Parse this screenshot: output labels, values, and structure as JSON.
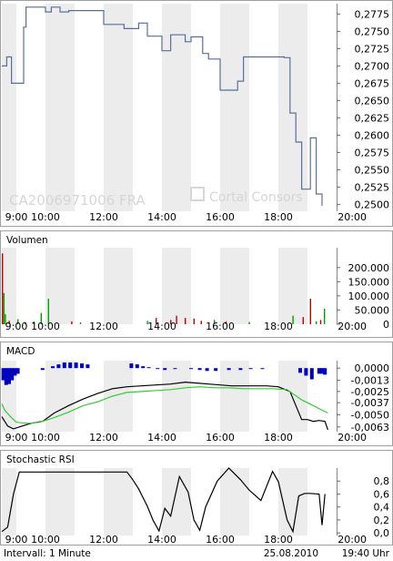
{
  "chart_data": [
    {
      "type": "line",
      "panel": "price",
      "ylim": [
        0.249,
        0.279
      ],
      "x_ticks": [
        "9:00",
        "10:00",
        "12:00",
        "14:00",
        "16:00",
        "18:00",
        "20:00"
      ],
      "y_ticks": [
        "0,2775",
        "0,2750",
        "0,2725",
        "0,2700",
        "0,2675",
        "0,2650",
        "0,2625",
        "0,2600",
        "0,2575",
        "0,2550",
        "0,2525",
        "0,2500"
      ],
      "y_tick_values": [
        0.2775,
        0.275,
        0.2725,
        0.27,
        0.2675,
        0.265,
        0.2625,
        0.26,
        0.2575,
        0.255,
        0.2525,
        0.25
      ],
      "x_range": [
        8.5,
        20.0
      ],
      "series": [
        {
          "color": "#5a6e9c",
          "x": [
            8.5,
            8.67,
            8.67,
            8.83,
            8.83,
            9.25,
            9.25,
            9.33,
            9.33,
            10.0,
            10.0,
            10.2,
            10.2,
            10.5,
            10.5,
            10.8,
            10.8,
            12.0,
            12.0,
            12.7,
            12.7,
            13.2,
            13.2,
            13.5,
            13.5,
            14.0,
            14.0,
            14.3,
            14.3,
            14.8,
            14.8,
            15.0,
            15.0,
            15.4,
            15.4,
            15.6,
            15.6,
            16.0,
            16.0,
            16.6,
            16.6,
            16.8,
            16.8,
            18.2,
            18.2,
            18.4,
            18.4,
            18.6,
            18.6,
            18.8,
            18.8,
            19.1,
            19.1,
            19.3,
            19.3,
            19.5,
            19.5
          ],
          "y": [
            0.27,
            0.27,
            0.2713,
            0.2713,
            0.2675,
            0.2675,
            0.2756,
            0.2756,
            0.2785,
            0.2785,
            0.2778,
            0.2778,
            0.2785,
            0.2785,
            0.2778,
            0.2778,
            0.278,
            0.278,
            0.276,
            0.276,
            0.2754,
            0.2754,
            0.2762,
            0.2762,
            0.2743,
            0.2743,
            0.2722,
            0.2722,
            0.2745,
            0.2745,
            0.2735,
            0.2735,
            0.2742,
            0.2742,
            0.2718,
            0.2718,
            0.271,
            0.271,
            0.2665,
            0.2665,
            0.2678,
            0.2678,
            0.2713,
            0.2713,
            0.2712,
            0.2712,
            0.2632,
            0.2632,
            0.259,
            0.259,
            0.2522,
            0.2522,
            0.2596,
            0.2596,
            0.2515,
            0.2515,
            0.2498
          ]
        }
      ],
      "watermark": "CA2006971006   FRA"
    },
    {
      "type": "bar",
      "panel": "volume",
      "title": "Volumen",
      "ylim": [
        0,
        270000
      ],
      "x_ticks": [
        "9:00",
        "10:00",
        "12:00",
        "14:00",
        "16:00",
        "18:00",
        "20:00"
      ],
      "y_ticks": [
        "200.000",
        "150.000",
        "100.000",
        "50.000",
        "0"
      ],
      "y_tick_values": [
        200000,
        150000,
        100000,
        50000,
        0
      ],
      "x_range": [
        8.5,
        20.0
      ],
      "bars": [
        {
          "x": 8.52,
          "v": 250000,
          "c": "#c00000"
        },
        {
          "x": 8.57,
          "v": 110000,
          "c": "#00a000"
        },
        {
          "x": 8.62,
          "v": 35000,
          "c": "#00a000"
        },
        {
          "x": 8.75,
          "v": 12000,
          "c": "#c00000"
        },
        {
          "x": 9.05,
          "v": 18000,
          "c": "#00a000"
        },
        {
          "x": 9.3,
          "v": 8000,
          "c": "#00a000"
        },
        {
          "x": 9.6,
          "v": 10000,
          "c": "#00a000"
        },
        {
          "x": 9.85,
          "v": 40000,
          "c": "#00a000"
        },
        {
          "x": 10.1,
          "v": 90000,
          "c": "#00a000"
        },
        {
          "x": 10.9,
          "v": 10000,
          "c": "#c00000"
        },
        {
          "x": 11.2,
          "v": 7000,
          "c": "#00a000"
        },
        {
          "x": 13.5,
          "v": 12000,
          "c": "#00a000"
        },
        {
          "x": 13.8,
          "v": 22000,
          "c": "#c00000"
        },
        {
          "x": 14.3,
          "v": 15000,
          "c": "#c00000"
        },
        {
          "x": 14.5,
          "v": 30000,
          "c": "#c00000"
        },
        {
          "x": 14.8,
          "v": 22000,
          "c": "#c00000"
        },
        {
          "x": 15.1,
          "v": 20000,
          "c": "#c00000"
        },
        {
          "x": 15.35,
          "v": 12000,
          "c": "#c00000"
        },
        {
          "x": 15.8,
          "v": 15000,
          "c": "#00a000"
        },
        {
          "x": 16.2,
          "v": 10000,
          "c": "#c00000"
        },
        {
          "x": 17.0,
          "v": 8000,
          "c": "#00a000"
        },
        {
          "x": 18.5,
          "v": 30000,
          "c": "#00a000"
        },
        {
          "x": 18.85,
          "v": 25000,
          "c": "#c00000"
        },
        {
          "x": 19.1,
          "v": 90000,
          "c": "#c00000"
        },
        {
          "x": 19.3,
          "v": 10000,
          "c": "#00a000"
        },
        {
          "x": 19.45,
          "v": 15000,
          "c": "#c00000"
        },
        {
          "x": 19.58,
          "v": 55000,
          "c": "#00a000"
        }
      ]
    },
    {
      "type": "line",
      "panel": "macd",
      "title": "MACD",
      "ylim": [
        -0.0068,
        0.0008
      ],
      "x_ticks": [
        "9:00",
        "10:00",
        "12:00",
        "14:00",
        "16:00",
        "18:00",
        "20:00"
      ],
      "y_ticks": [
        "0,0000",
        "-0,0013",
        "-0,0025",
        "-0,0037",
        "-0,0050",
        "-0,0063"
      ],
      "y_tick_values": [
        0.0,
        -0.0013,
        -0.0025,
        -0.0037,
        -0.005,
        -0.0063
      ],
      "x_range": [
        8.5,
        20.0
      ],
      "histogram": [
        {
          "x": 8.55,
          "v": -0.0013
        },
        {
          "x": 8.65,
          "v": -0.0018
        },
        {
          "x": 8.75,
          "v": -0.0017
        },
        {
          "x": 8.85,
          "v": -0.0013
        },
        {
          "x": 8.95,
          "v": -0.0008
        },
        {
          "x": 9.05,
          "v": -0.0006
        },
        {
          "x": 9.9,
          "v": -0.0002
        },
        {
          "x": 10.25,
          "v": 0.0002
        },
        {
          "x": 10.45,
          "v": 0.0004
        },
        {
          "x": 10.65,
          "v": 0.0006
        },
        {
          "x": 10.85,
          "v": 0.0006
        },
        {
          "x": 11.05,
          "v": 0.0006
        },
        {
          "x": 11.25,
          "v": 0.0005
        },
        {
          "x": 11.45,
          "v": 0.0004
        },
        {
          "x": 12.95,
          "v": 0.0005
        },
        {
          "x": 13.15,
          "v": 0.0004
        },
        {
          "x": 13.35,
          "v": 0.0002
        },
        {
          "x": 13.55,
          "v": 0.0001
        },
        {
          "x": 13.85,
          "v": -0.0001
        },
        {
          "x": 14.1,
          "v": -0.0002
        },
        {
          "x": 14.45,
          "v": -0.0001
        },
        {
          "x": 15.0,
          "v": -0.0001
        },
        {
          "x": 15.3,
          "v": -0.0002
        },
        {
          "x": 15.55,
          "v": -0.0003
        },
        {
          "x": 15.85,
          "v": -0.0003
        },
        {
          "x": 16.3,
          "v": -0.0002
        },
        {
          "x": 16.7,
          "v": -0.0002
        },
        {
          "x": 17.05,
          "v": -0.0001
        },
        {
          "x": 17.45,
          "v": -0.0001
        },
        {
          "x": 18.75,
          "v": -0.0005
        },
        {
          "x": 18.95,
          "v": -0.0008
        },
        {
          "x": 19.15,
          "v": -0.0012
        },
        {
          "x": 19.4,
          "v": -0.0006
        },
        {
          "x": 19.5,
          "v": -0.0006
        },
        {
          "x": 19.6,
          "v": -0.0007
        }
      ],
      "series": [
        {
          "color": "#000000",
          "x": [
            8.5,
            8.7,
            8.9,
            9.2,
            9.5,
            9.9,
            10.3,
            10.8,
            11.3,
            11.8,
            12.3,
            12.8,
            13.3,
            13.8,
            14.3,
            14.8,
            15.2,
            15.6,
            16.0,
            16.4,
            16.8,
            17.2,
            17.6,
            18.0,
            18.4,
            18.6,
            18.8,
            19.0,
            19.2,
            19.4,
            19.6,
            19.7
          ],
          "y": [
            -0.0052,
            -0.0062,
            -0.0065,
            -0.0062,
            -0.0059,
            -0.0057,
            -0.0048,
            -0.004,
            -0.0033,
            -0.0027,
            -0.0022,
            -0.002,
            -0.0019,
            -0.0018,
            -0.0017,
            -0.0015,
            -0.0016,
            -0.0017,
            -0.0018,
            -0.0019,
            -0.0019,
            -0.0019,
            -0.0019,
            -0.002,
            -0.0025,
            -0.004,
            -0.0055,
            -0.0055,
            -0.0057,
            -0.0056,
            -0.0057,
            -0.0066
          ]
        },
        {
          "color": "#33cc33",
          "x": [
            8.5,
            8.6,
            8.8,
            9.0,
            9.4,
            9.8,
            10.3,
            10.8,
            11.3,
            11.8,
            12.3,
            12.8,
            13.3,
            13.8,
            14.3,
            14.8,
            15.3,
            15.8,
            16.3,
            16.8,
            17.3,
            17.8,
            18.3,
            18.8,
            19.2,
            19.5,
            19.7
          ],
          "y": [
            -0.0038,
            -0.0045,
            -0.0052,
            -0.0058,
            -0.0059,
            -0.0058,
            -0.0053,
            -0.0047,
            -0.004,
            -0.0036,
            -0.003,
            -0.0026,
            -0.0025,
            -0.0024,
            -0.0023,
            -0.0021,
            -0.002,
            -0.0021,
            -0.0021,
            -0.0022,
            -0.0022,
            -0.0022,
            -0.0023,
            -0.0034,
            -0.004,
            -0.0045,
            -0.0048
          ]
        }
      ]
    },
    {
      "type": "line",
      "panel": "stochastic",
      "title": "Stochastic RSI",
      "ylim": [
        -0.04,
        1.0
      ],
      "x_ticks": [
        "9:00",
        "10:00",
        "12:00",
        "14:00",
        "16:00",
        "18:00",
        "20:00"
      ],
      "y_ticks": [
        "0,8",
        "0,6",
        "0,4",
        "0,2",
        "0,0"
      ],
      "y_tick_values": [
        0.8,
        0.6,
        0.4,
        0.2,
        0.0
      ],
      "x_range": [
        8.5,
        20.0
      ],
      "series": [
        {
          "color": "#000000",
          "x": [
            8.5,
            8.7,
            8.9,
            9.1,
            9.4,
            9.8,
            10.3,
            10.8,
            11.3,
            11.8,
            12.3,
            12.8,
            13.0,
            13.2,
            13.5,
            13.7,
            13.9,
            14.1,
            14.3,
            14.6,
            14.9,
            15.1,
            15.3,
            15.5,
            15.9,
            16.3,
            16.7,
            17.0,
            17.4,
            17.8,
            18.0,
            18.3,
            18.5,
            18.7,
            18.9,
            19.1,
            19.4,
            19.5,
            19.6
          ],
          "y": [
            0.02,
            0.09,
            0.6,
            0.94,
            0.94,
            0.94,
            0.94,
            0.94,
            0.94,
            0.94,
            0.94,
            0.94,
            0.82,
            0.68,
            0.41,
            0.19,
            0.03,
            0.38,
            0.26,
            0.87,
            0.63,
            0.2,
            0.04,
            0.4,
            0.8,
            1.0,
            0.82,
            0.66,
            0.5,
            0.95,
            0.79,
            0.2,
            0.02,
            0.57,
            0.61,
            0.61,
            0.6,
            0.12,
            0.6
          ]
        }
      ]
    }
  ],
  "footer": {
    "interval": "Intervall: 1 Minute",
    "date": "25.08.2010",
    "time": "19:40 Uhr"
  },
  "colors": {
    "border": "#a0a0a0",
    "band": "#ececec",
    "price_line": "#5a6e9c",
    "vol_up": "#00a000",
    "vol_down": "#c00000",
    "macd_hist": "#0000c0",
    "macd_signal": "#33cc33"
  }
}
